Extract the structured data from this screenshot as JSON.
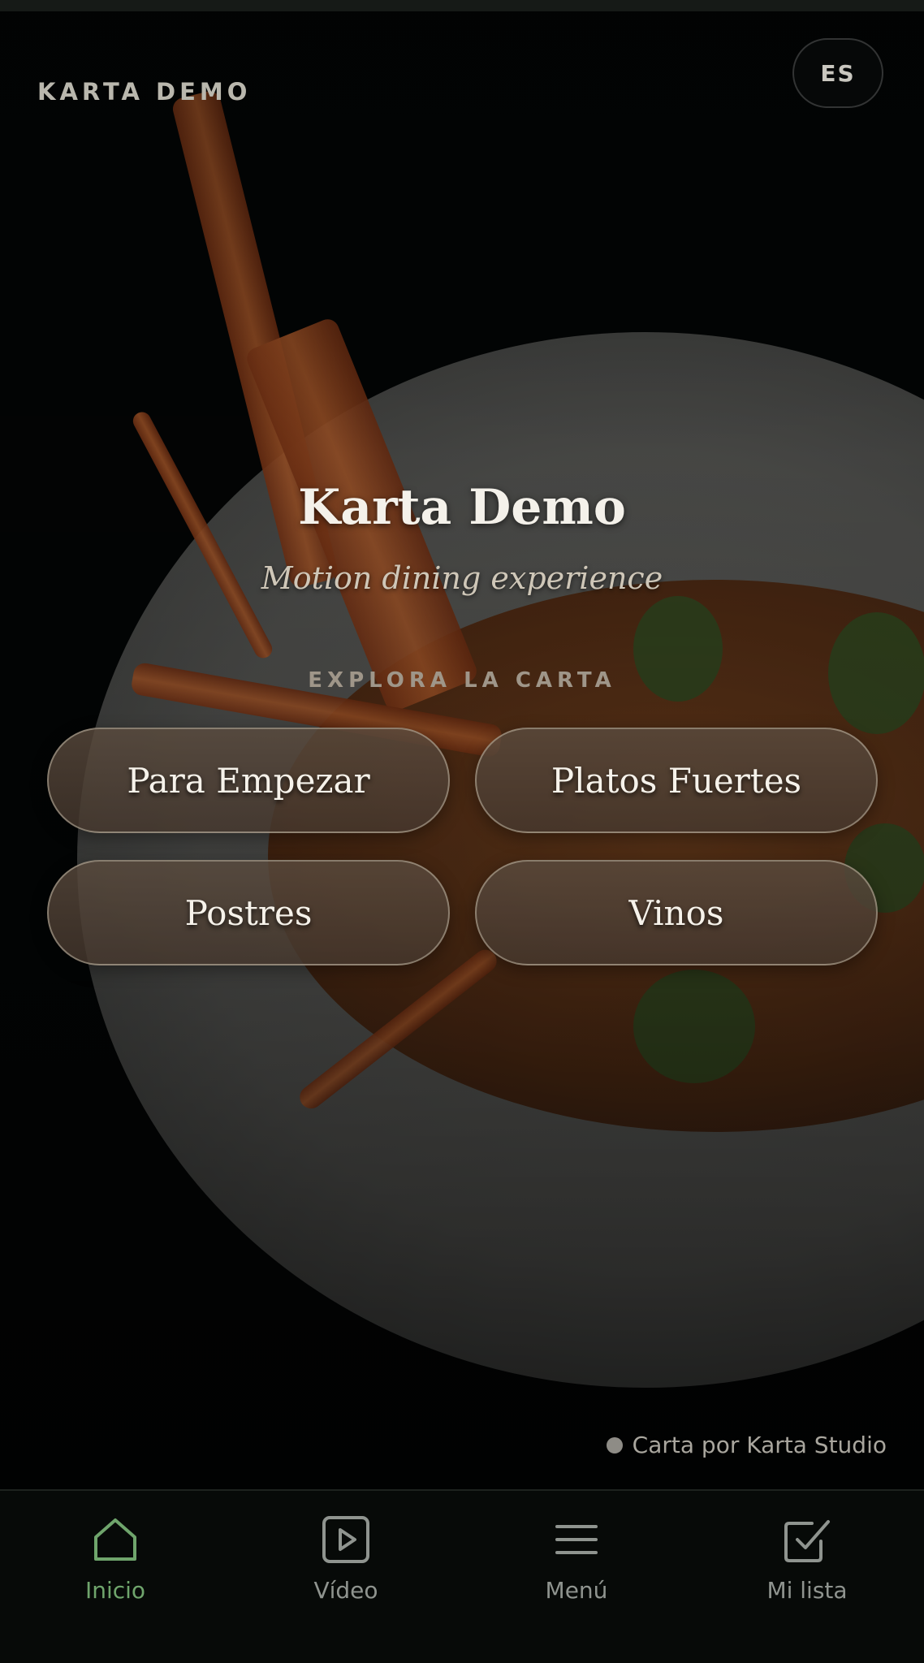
{
  "header": {
    "brand": "KARTA DEMO",
    "language_button": "ES"
  },
  "hero": {
    "title": "Karta Demo",
    "subtitle": "Motion dining experience",
    "section_label": "EXPLORA LA CARTA"
  },
  "categories": [
    {
      "label": "Para Empezar"
    },
    {
      "label": "Platos Fuertes"
    },
    {
      "label": "Postres"
    },
    {
      "label": "Vinos"
    }
  ],
  "footer": {
    "credit": "Carta por Karta Studio"
  },
  "bottom_nav": {
    "items": [
      {
        "label": "Inicio",
        "icon": "home-icon",
        "active": true
      },
      {
        "label": "Vídeo",
        "icon": "play-icon",
        "active": false
      },
      {
        "label": "Menú",
        "icon": "menu-icon",
        "active": false
      },
      {
        "label": "Mi lista",
        "icon": "checklist-icon",
        "active": false
      }
    ],
    "active_color": "#6fa56c",
    "inactive_color": "#8f948f"
  }
}
